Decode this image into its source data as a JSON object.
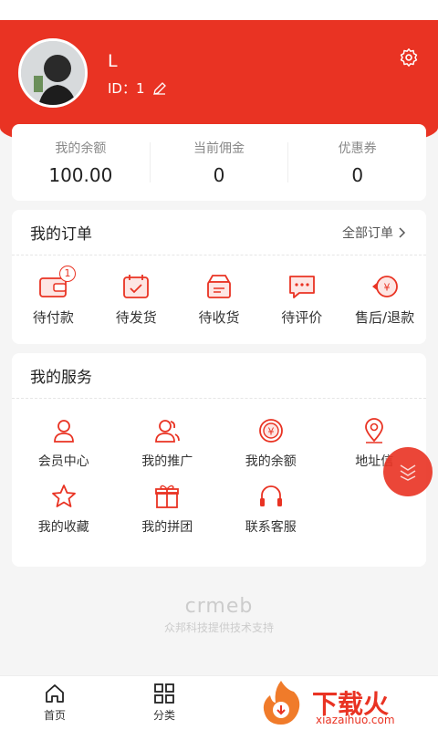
{
  "user": {
    "name": "L",
    "id": "ID：1"
  },
  "wallet": [
    {
      "label": "我的余额",
      "value": "100.00"
    },
    {
      "label": "当前佣金",
      "value": "0"
    },
    {
      "label": "优惠券",
      "value": "0"
    }
  ],
  "orders": {
    "title": "我的订单",
    "more": "全部订单",
    "items": [
      {
        "label": "待付款",
        "badge": "1"
      },
      {
        "label": "待发货"
      },
      {
        "label": "待收货"
      },
      {
        "label": "待评价"
      },
      {
        "label": "售后/退款"
      }
    ]
  },
  "services": {
    "title": "我的服务",
    "items": [
      {
        "label": "会员中心"
      },
      {
        "label": "我的推广"
      },
      {
        "label": "我的余额"
      },
      {
        "label": "地址信"
      },
      {
        "label": "我的收藏"
      },
      {
        "label": "我的拼团"
      },
      {
        "label": "联系客服"
      }
    ]
  },
  "brand": {
    "logo": "crmeb",
    "text": "众邦科技提供技术支持"
  },
  "tabs": [
    {
      "label": "首页"
    },
    {
      "label": "分类"
    }
  ],
  "watermark": {
    "text": "下载火",
    "sub": "xiazaihuo.com"
  },
  "colors": {
    "primary": "#e93323"
  }
}
